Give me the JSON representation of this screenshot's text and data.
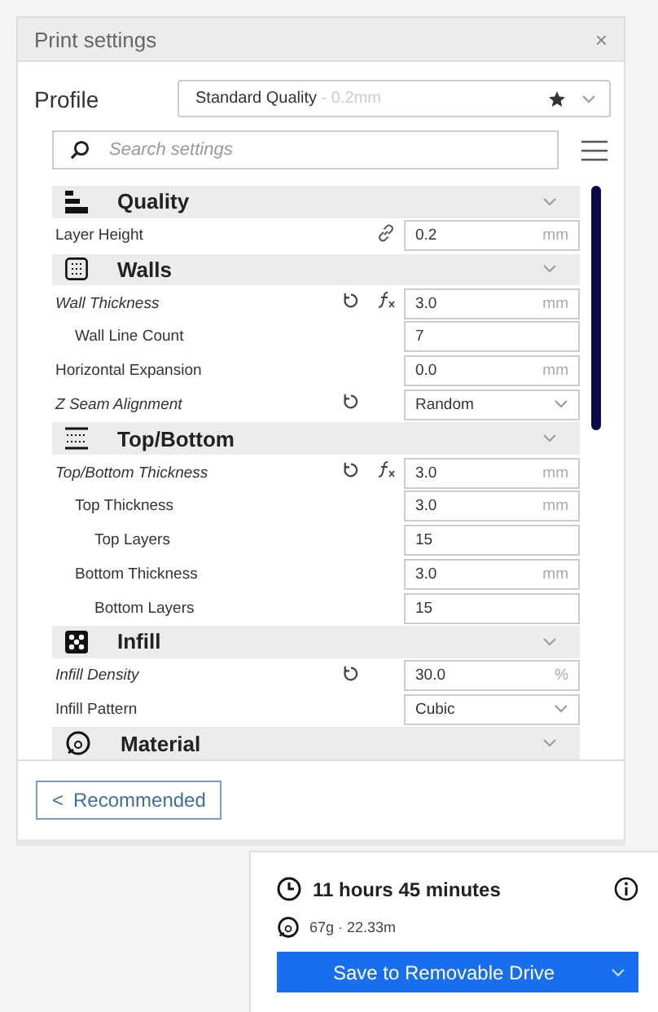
{
  "panel": {
    "title": "Print settings",
    "close": "×"
  },
  "profile": {
    "label": "Profile",
    "name": "Standard Quality",
    "detail": " - 0.2mm",
    "favorite": true
  },
  "search": {
    "placeholder": "Search settings"
  },
  "sections": [
    {
      "title": "Quality",
      "expanded": true,
      "settings": [
        {
          "label": "Layer Height",
          "modified": false,
          "linked": true,
          "reset": false,
          "function": false,
          "kind": "number",
          "value": "0.2",
          "unit": "mm"
        }
      ]
    },
    {
      "title": "Walls",
      "expanded": true,
      "settings": [
        {
          "label": "Wall Thickness",
          "modified": true,
          "linked": false,
          "reset": true,
          "function": true,
          "kind": "number",
          "value": "3.0",
          "unit": "mm",
          "children": [
            {
              "label": "Wall Line Count",
              "modified": false,
              "linked": false,
              "reset": false,
              "function": false,
              "kind": "number",
              "value": "7"
            }
          ]
        },
        {
          "label": "Horizontal Expansion",
          "modified": false,
          "linked": false,
          "reset": false,
          "function": false,
          "kind": "number",
          "value": "0.0",
          "unit": "mm"
        },
        {
          "label": "Z Seam Alignment",
          "modified": true,
          "linked": false,
          "reset": true,
          "function": false,
          "kind": "select",
          "value": "Random"
        }
      ]
    },
    {
      "title": "Top/Bottom",
      "expanded": true,
      "settings": [
        {
          "label": "Top/Bottom Thickness",
          "modified": true,
          "linked": false,
          "reset": true,
          "function": true,
          "kind": "number",
          "value": "3.0",
          "unit": "mm",
          "children": [
            {
              "label": "Top Thickness",
              "modified": false,
              "linked": false,
              "reset": false,
              "function": false,
              "kind": "number",
              "value": "3.0",
              "unit": "mm",
              "children": [
                {
                  "label": "Top Layers",
                  "modified": false,
                  "linked": false,
                  "reset": false,
                  "function": false,
                  "kind": "number",
                  "value": "15"
                }
              ]
            },
            {
              "label": "Bottom Thickness",
              "modified": false,
              "linked": false,
              "reset": false,
              "function": false,
              "kind": "number",
              "value": "3.0",
              "unit": "mm",
              "children": [
                {
                  "label": "Bottom Layers",
                  "modified": false,
                  "linked": false,
                  "reset": false,
                  "function": false,
                  "kind": "number",
                  "value": "15"
                }
              ]
            }
          ]
        }
      ]
    },
    {
      "title": "Infill",
      "expanded": true,
      "settings": [
        {
          "label": "Infill Density",
          "modified": true,
          "linked": false,
          "reset": true,
          "function": false,
          "kind": "number",
          "value": "30.0",
          "unit": "%"
        },
        {
          "label": "Infill Pattern",
          "modified": false,
          "linked": false,
          "reset": false,
          "function": false,
          "kind": "select",
          "value": "Cubic"
        }
      ]
    },
    {
      "title": "Material",
      "expanded": true
    }
  ],
  "mode_button": {
    "arrow": "<",
    "label": "Recommended"
  },
  "estimate": {
    "time": "11 hours 45 minutes",
    "material": "67g · 22.33m",
    "action": "Save to Removable Drive"
  }
}
